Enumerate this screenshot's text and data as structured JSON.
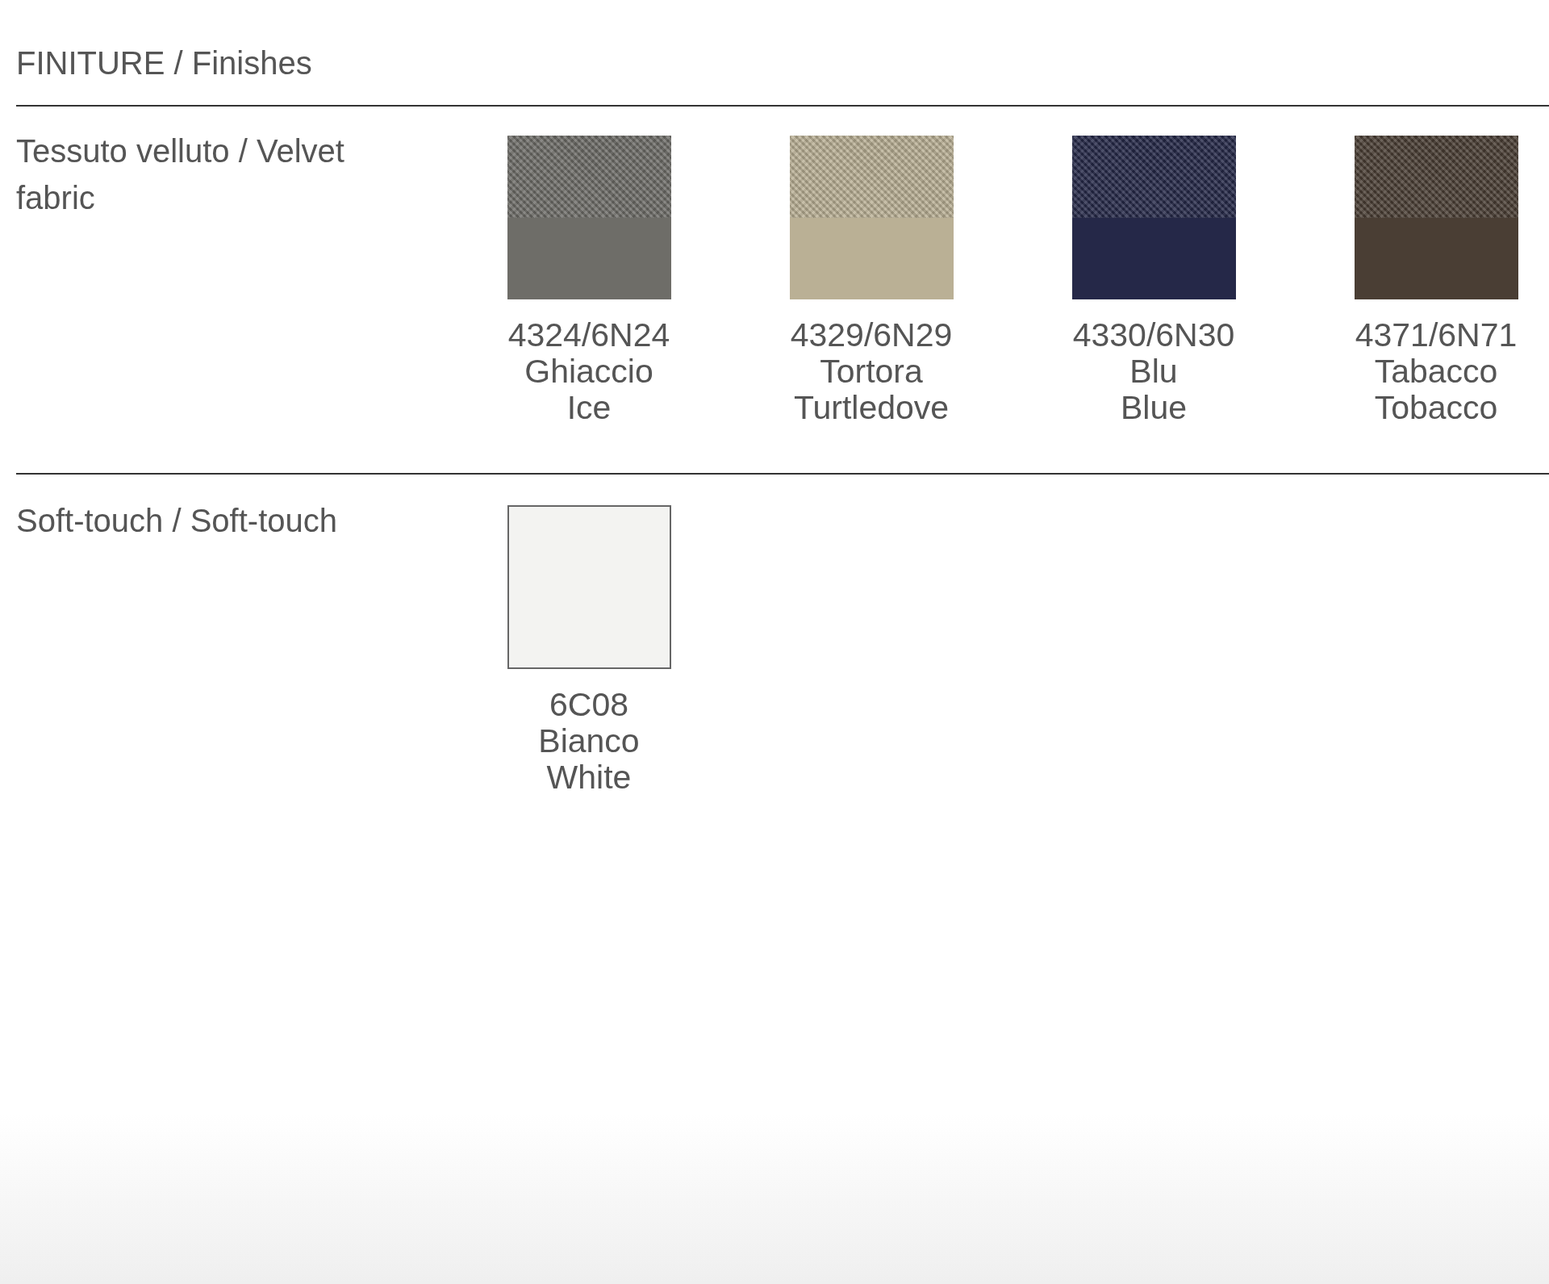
{
  "title": "FINITURE / Finishes",
  "sections": [
    {
      "label": "Tessuto velluto / Velvet fabric",
      "kind": "textured",
      "swatches": [
        {
          "code": "4324/6N24",
          "name_it": "Ghiaccio",
          "name_en": "Ice",
          "color": "#6e6d68"
        },
        {
          "code": "4329/6N29",
          "name_it": "Tortora",
          "name_en": "Turtledove",
          "color": "#bab095"
        },
        {
          "code": "4330/6N30",
          "name_it": "Blu",
          "name_en": "Blue",
          "color": "#252848"
        },
        {
          "code": "4371/6N71",
          "name_it": "Tabacco",
          "name_en": "Tobacco",
          "color": "#4a3e34"
        }
      ]
    },
    {
      "label": "Soft-touch / Soft-touch",
      "kind": "plain",
      "swatches": [
        {
          "code": "6C08",
          "name_it": "Bianco",
          "name_en": "White",
          "color": "#f3f3f1"
        }
      ]
    }
  ]
}
